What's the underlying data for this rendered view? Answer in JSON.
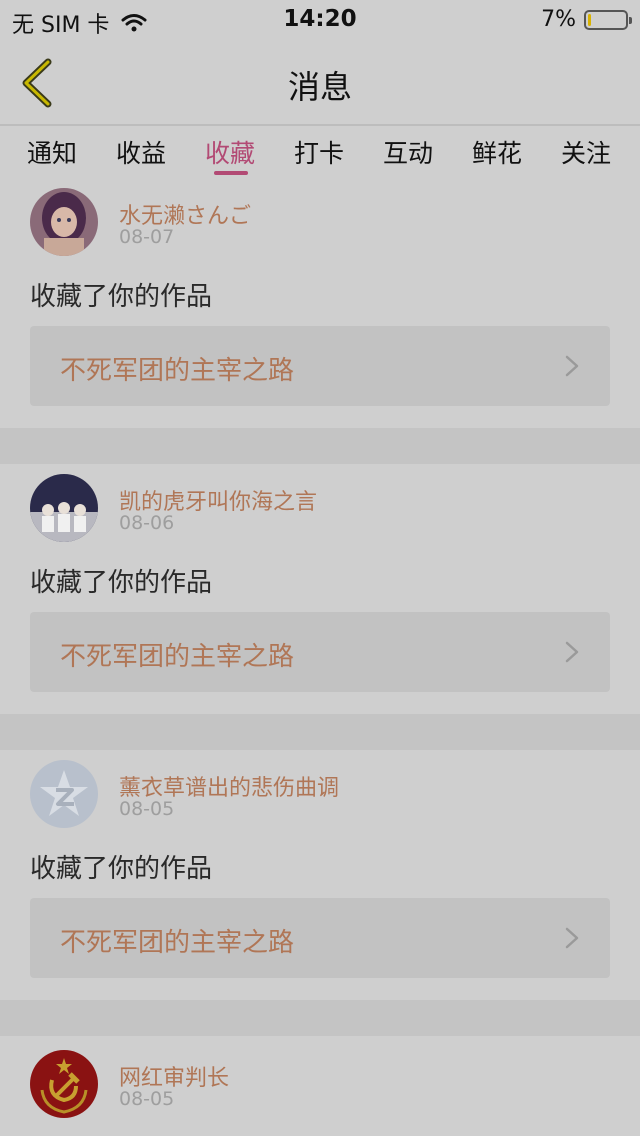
{
  "status": {
    "carrier": "无 SIM 卡",
    "time": "14:20",
    "battery": "7%",
    "battery_level": 0.07
  },
  "nav": {
    "title": "消息",
    "back_icon": "chevron-left-icon"
  },
  "tabs": [
    {
      "label": "通知",
      "active": false
    },
    {
      "label": "收益",
      "active": false
    },
    {
      "label": "收藏",
      "active": true
    },
    {
      "label": "打卡",
      "active": false
    },
    {
      "label": "互动",
      "active": false
    },
    {
      "label": "鲜花",
      "active": false
    },
    {
      "label": "关注",
      "active": false
    }
  ],
  "items": [
    {
      "user": "水无濑さんご",
      "date": "08-07",
      "action": "收藏了你的作品",
      "work": "不死军团的主宰之路",
      "avatar": "anime-girl-avatar"
    },
    {
      "user": "凯的虎牙叫你海之言",
      "date": "08-06",
      "action": "收藏了你的作品",
      "work": "不死军团的主宰之路",
      "avatar": "group-photo-avatar"
    },
    {
      "user": "薰衣草谱出的悲伤曲调",
      "date": "08-05",
      "action": "收藏了你的作品",
      "work": "不死军团的主宰之路",
      "avatar": "qzone-star-avatar"
    },
    {
      "user": "网红审判长",
      "date": "08-05",
      "action": "",
      "work": "",
      "avatar": "hammer-sickle-avatar"
    }
  ],
  "colors": {
    "accent": "#b24a74",
    "username": "#b07656",
    "background": "#cfcfcf"
  }
}
